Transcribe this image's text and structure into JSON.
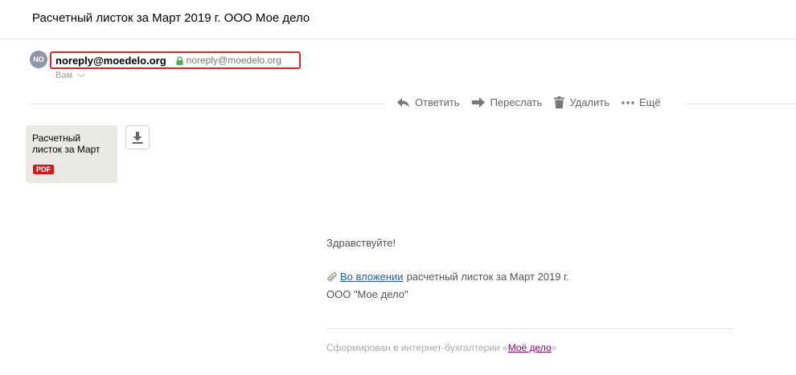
{
  "message": {
    "subject": "Расчетный листок за Март 2019 г. ООО Мое дело"
  },
  "sender": {
    "avatar_initials": "NO",
    "name": "noreply@moedelo.org",
    "email": "noreply@moedelo.org",
    "recipient_label": "Вам"
  },
  "actions": {
    "reply": "Ответить",
    "forward": "Переслать",
    "delete": "Удалить",
    "more": "Ещё"
  },
  "attachment": {
    "name": "Расчетный листок за Март",
    "type_badge": "PDF",
    "badge_color": "#d31b1b"
  },
  "body": {
    "greeting": "Здравствуйте!",
    "attachment_link": "Во вложении",
    "line1_rest": "расчетный листок за Март 2019 г.",
    "line2": "ООО \"Мое дело\"",
    "footer_prefix": "Сформирован в интернет-бухгалтерии «",
    "footer_link": "Моё дело",
    "footer_suffix": "»"
  },
  "colors": {
    "highlight_border": "#d8262b",
    "link": "#2b5da8",
    "visited_link": "#800080",
    "lock": "#4caf50"
  }
}
